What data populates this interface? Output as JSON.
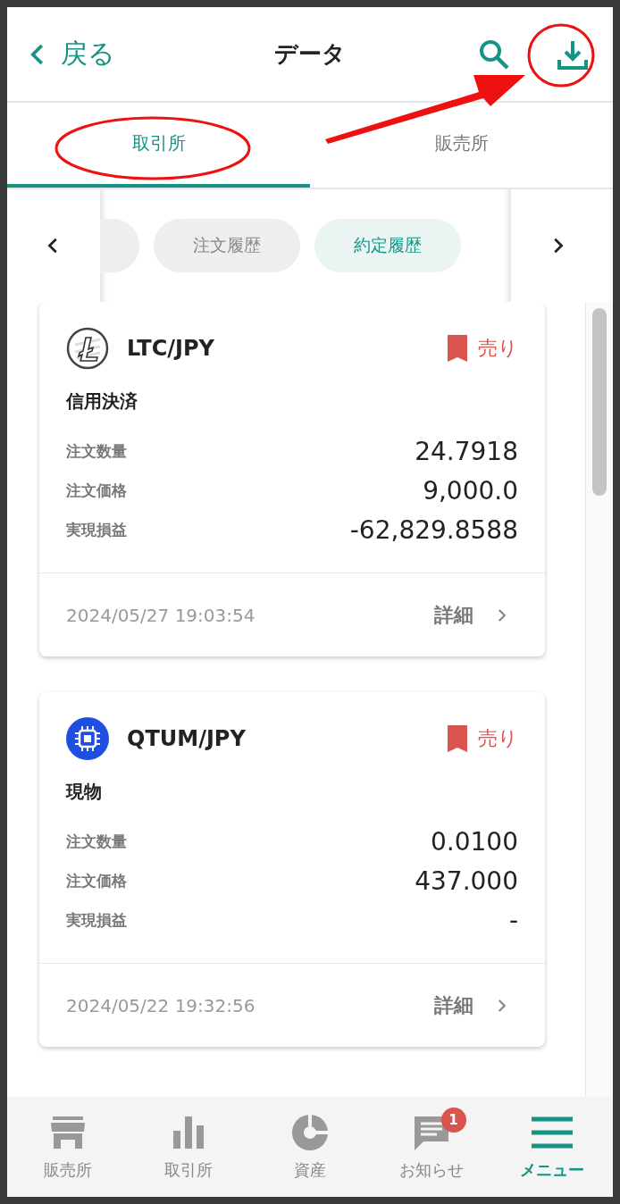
{
  "header": {
    "back_label": "戻る",
    "title": "データ"
  },
  "tabs": [
    {
      "label": "取引所",
      "selected": true
    },
    {
      "label": "販売所",
      "selected": false
    }
  ],
  "filters": [
    {
      "label": "注文履歴",
      "selected": false
    },
    {
      "label": "約定履歴",
      "selected": true
    }
  ],
  "trades": [
    {
      "kind": "ltc",
      "pair": "LTC/JPY",
      "color": "#d9534f",
      "side": "売り",
      "type": "信用決済",
      "rows": [
        {
          "label": "注文数量",
          "value": "24.7918"
        },
        {
          "label": "注文価格",
          "value": "9,000.0"
        },
        {
          "label": "実現損益",
          "value": "-62,829.8588"
        }
      ],
      "datetime": "2024/05/27 19:03:54",
      "detail": "詳細"
    },
    {
      "kind": "qtum",
      "pair": "QTUM/JPY",
      "color": "#d9534f",
      "side": "売り",
      "type": "現物",
      "rows": [
        {
          "label": "注文数量",
          "value": "0.0100"
        },
        {
          "label": "注文価格",
          "value": "437.000"
        },
        {
          "label": "実現損益",
          "value": "-"
        }
      ],
      "datetime": "2024/05/22 19:32:56",
      "detail": "詳細"
    }
  ],
  "nav": [
    {
      "kind": "shop",
      "label": "販売所",
      "selected": false
    },
    {
      "kind": "bars",
      "label": "取引所",
      "selected": false
    },
    {
      "kind": "pie",
      "label": "資産",
      "selected": false
    },
    {
      "kind": "news",
      "label": "お知らせ",
      "selected": false,
      "badge": "1"
    },
    {
      "kind": "menu",
      "label": "メニュー",
      "selected": true
    }
  ]
}
